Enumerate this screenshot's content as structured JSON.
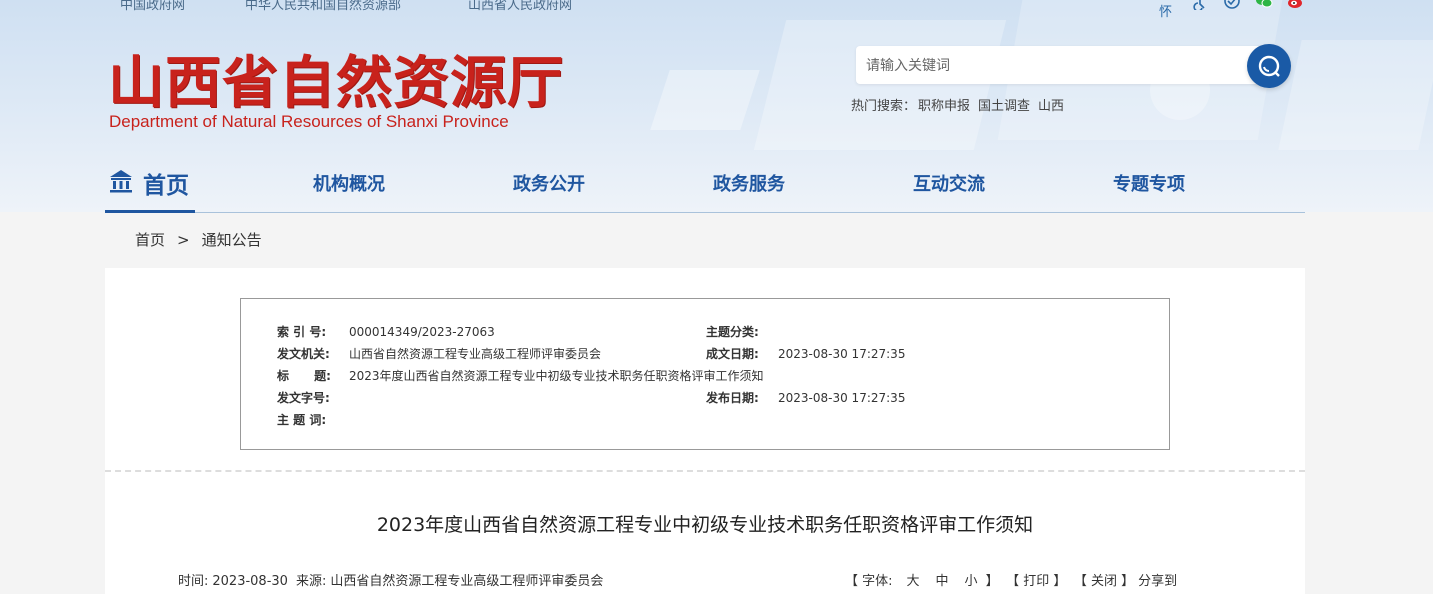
{
  "top_links": [
    "中国政府网",
    "中华人民共和国自然资源部",
    "山西省人民政府网"
  ],
  "top_icons": {
    "care_label": "关怀",
    "icons": [
      "accessibility-icon",
      "mobile-icon",
      "wechat-icon",
      "weibo-icon"
    ]
  },
  "logo": {
    "cn": "山西省自然资源厅",
    "en": "Department of Natural Resources of Shanxi Province"
  },
  "search": {
    "placeholder": "请输入关键词",
    "hot_label": "热门搜索：",
    "hot_terms": [
      "职称申报",
      "国土调查",
      "山西"
    ]
  },
  "nav": {
    "home": "首页",
    "items": [
      "机构概况",
      "政务公开",
      "政务服务",
      "互动交流",
      "专题专项"
    ]
  },
  "breadcrumb": {
    "home": "首页",
    "sep": ">",
    "current": "通知公告"
  },
  "meta": {
    "index_k": "索 引 号:",
    "index_v": "000014349/2023-27063",
    "topic_k": "主题分类:",
    "topic_v": "",
    "org_k": "发文机关:",
    "org_v": "山西省自然资源工程专业高级工程师评审委员会",
    "date_k": "成文日期:",
    "date_v": "2023-08-30 17:27:35",
    "title_k": "标      题:",
    "title_v": "2023年度山西省自然资源工程专业中初级专业技术职务任职资格评审工作须知",
    "docno_k": "发文字号:",
    "docno_v": "",
    "pub_k": "发布日期:",
    "pub_v": "2023-08-30 17:27:35",
    "kw_k": "主 题 词:",
    "kw_v": ""
  },
  "article": {
    "title": "2023年度山西省自然资源工程专业中初级专业技术职务任职资格评审工作须知",
    "time_label": "时间:",
    "time": "2023-08-30",
    "source_label": "来源:",
    "source": "山西省自然资源工程专业高级工程师评审委员会"
  },
  "tools": {
    "font_open": "【 字体:",
    "large": "大",
    "medium": "中",
    "small": "小",
    "font_close": "】",
    "print": "【 打印 】",
    "close": "【 关闭 】",
    "share": "分享到"
  },
  "colors": {
    "brand_red": "#c8221c",
    "brand_blue": "#1f56a0"
  }
}
